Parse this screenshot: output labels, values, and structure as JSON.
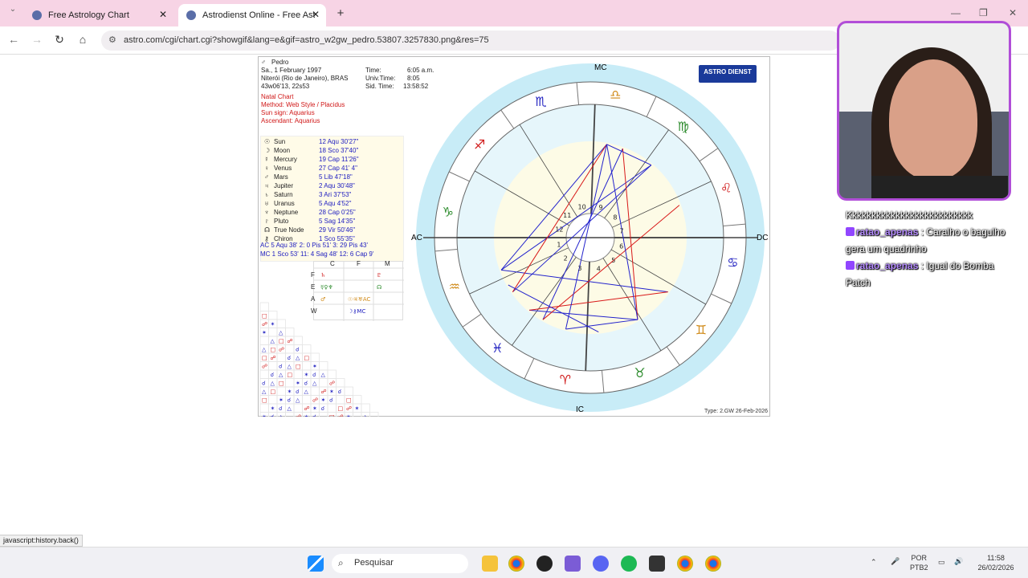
{
  "browser": {
    "tabs": [
      {
        "title": "Free Astrology Chart"
      },
      {
        "title": "Astrodienst Online - Free Astro"
      }
    ],
    "url": "astro.com/cgi/chart.cgi?showgif&lang=e&gif=astro_w2gw_pedro.53807.3257830.png&res=75",
    "status_text": "javascript:history.back()"
  },
  "chart_header": {
    "name": "Pedro",
    "date": "Sa., 1 February 1997",
    "place": "Niterói (Rio de Janeiro), BRAS",
    "coords": "43w06'13, 22s53",
    "time_label": "Time:",
    "time": "6:05 a.m.",
    "ut_label": "Univ.Time:",
    "ut": "8:05",
    "sid_label": "Sid. Time:",
    "sid": "13:58:52",
    "chart_type": "Natal Chart",
    "method": "Method: Web Style / Placidus",
    "sun_sign": "Sun sign: Aquarius",
    "ascendant": "Ascendant: Aquarius"
  },
  "planets": [
    {
      "glyph": "☉",
      "name": "Sun",
      "pos": "12 Aqu 30'27\""
    },
    {
      "glyph": "☽",
      "name": "Moon",
      "pos": "18 Sco 37'40\""
    },
    {
      "glyph": "☿",
      "name": "Mercury",
      "pos": "19 Cap 11'26\""
    },
    {
      "glyph": "♀",
      "name": "Venus",
      "pos": "27 Cap 41' 4\""
    },
    {
      "glyph": "♂",
      "name": "Mars",
      "pos": "5 Lib 47'18\""
    },
    {
      "glyph": "♃",
      "name": "Jupiter",
      "pos": "2 Aqu 30'48\""
    },
    {
      "glyph": "♄",
      "name": "Saturn",
      "pos": "3 Ari 37'53\""
    },
    {
      "glyph": "♅",
      "name": "Uranus",
      "pos": "5 Aqu 4'52\""
    },
    {
      "glyph": "♆",
      "name": "Neptune",
      "pos": "28 Cap 0'25\""
    },
    {
      "glyph": "♇",
      "name": "Pluto",
      "pos": "5 Sag 14'35\""
    },
    {
      "glyph": "☊",
      "name": "True Node",
      "pos": "29 Vir 50'46\""
    },
    {
      "glyph": "⚷",
      "name": "Chiron",
      "pos": "1 Sco 55'35\""
    }
  ],
  "houses_line1": "AC 5 Aqu 38'  2: 0 Pis 51'  3: 29 Pis 43'",
  "houses_line2": "MC 1 Sco 53' 11: 4 Sag 48' 12: 6 Cap 9'",
  "element_table": {
    "headers": [
      "C",
      "F",
      "M"
    ],
    "rows": [
      "F",
      "E",
      "A",
      "W"
    ]
  },
  "wheel": {
    "mc": "MC",
    "ic": "IC",
    "ac": "AC",
    "dc": "DC"
  },
  "logo": {
    "name": "ASTRO DIENST",
    "url": "www.astro.com"
  },
  "type_info": "Type: 2.GW  26-Feb-2026",
  "chat": [
    {
      "user": "",
      "text": "Kkkkkkkkkkkkkkkkkkkkkkkkkk"
    },
    {
      "user": "ratao_apenas",
      "text": ": Caralho o bagulho gera um quadrinho"
    },
    {
      "user": "ratao_apenas",
      "text": ": Igual do Bomba Patch"
    }
  ],
  "taskbar": {
    "search_placeholder": "Pesquisar",
    "lang": "POR",
    "layout": "PTB2",
    "time": "11:58",
    "date": "26/02/2026"
  },
  "colors": {
    "tab_bar": "#f7d4e5",
    "wheel_outer": "#c8ecf7",
    "aspect_blue": "#2222cc",
    "aspect_red": "#d81818",
    "frame": "#b14ed8"
  }
}
